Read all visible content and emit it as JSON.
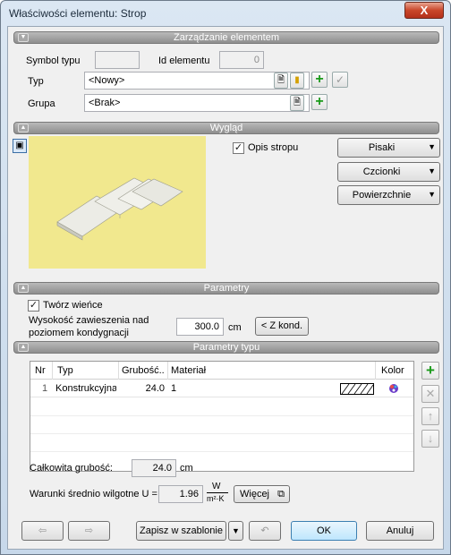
{
  "window": {
    "title": "Właściwości elementu: Strop",
    "close_glyph": "X"
  },
  "sections": {
    "management": "Zarządzanie elementem",
    "appearance": "Wygląd",
    "parameters": "Parametry",
    "type_parameters": "Parametry typu"
  },
  "management": {
    "symbol_label": "Symbol typu",
    "symbol_value": "",
    "id_label": "Id elementu",
    "id_value": "0",
    "type_label": "Typ",
    "type_value": "<Nowy>",
    "group_label": "Grupa",
    "group_value": "<Brak>"
  },
  "appearance": {
    "opis_label": "Opis stropu",
    "opis_checked": true,
    "buttons": [
      "Pisaki",
      "Czcionki",
      "Powierzchnie"
    ],
    "preview_bg": "#f1e88e"
  },
  "parameters": {
    "wience_label": "Twórz wieńce",
    "wience_checked": true,
    "height_label_1": "Wysokość zawieszenia nad",
    "height_label_2": "poziomem kondygnacji",
    "height_value": "300.0",
    "height_unit": "cm",
    "zkond_button": "< Z kond."
  },
  "layers": {
    "columns": [
      "Nr",
      "Typ",
      "Grubość...",
      "Materiał",
      "Kolor"
    ],
    "rows": [
      {
        "nr": "1",
        "typ": "Konstrukcyjna",
        "grubosc": "24.0",
        "material": "1"
      }
    ]
  },
  "totals": {
    "thickness_label": "Całkowita grubość:",
    "thickness_value": "24.0",
    "thickness_unit": "cm",
    "u_label": "Warunki średnio wilgotne U =",
    "u_value": "1.96",
    "u_unit_num": "W",
    "u_unit_den": "m²·K",
    "more_button": "Więcej"
  },
  "footer": {
    "save_template": "Zapisz w szablonie",
    "ok": "OK",
    "cancel": "Anuluj"
  }
}
